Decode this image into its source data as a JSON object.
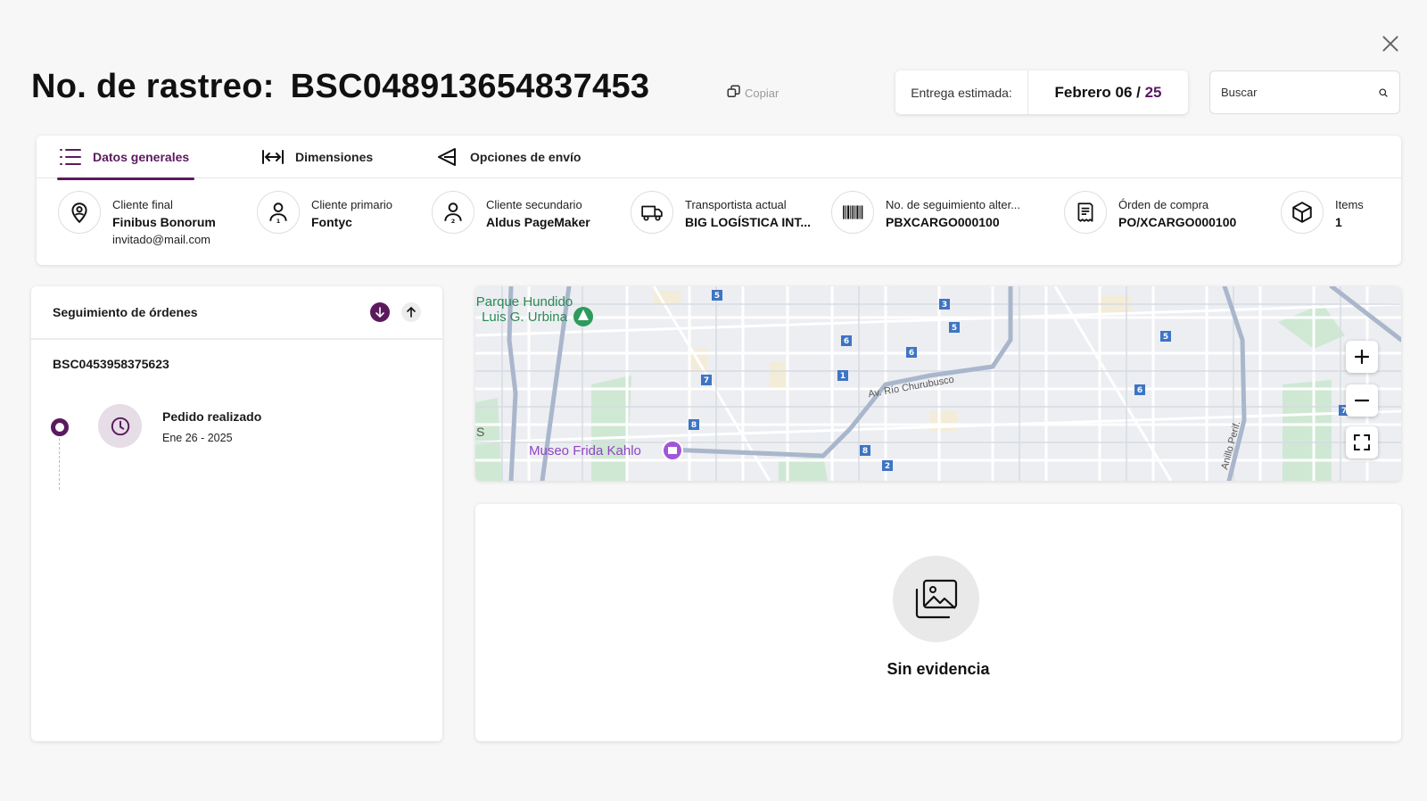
{
  "header": {
    "title_label": "No. de rastreo:",
    "tracking_number": "BSC0489136548374​53",
    "copy_label": "Copiar",
    "delivery_label": "Entrega estimada:",
    "delivery_date": "Febrero 06 /",
    "delivery_day": "25",
    "search_placeholder": "Buscar"
  },
  "tabs": [
    {
      "label": "Datos generales",
      "icon": "list-icon",
      "active": true
    },
    {
      "label": "Dimensiones",
      "icon": "dimensions-icon",
      "active": false
    },
    {
      "label": "Opciones de envío",
      "icon": "send-icon",
      "active": false
    }
  ],
  "fields": [
    {
      "label": "Cliente final",
      "value": "Finibus Bonorum",
      "sub": "invitado@mail.com",
      "icon": "location-pin-icon"
    },
    {
      "label": "Cliente primario",
      "value": "Fontyc",
      "icon": "user-1-icon"
    },
    {
      "label": "Cliente secundario",
      "value": "Aldus PageMaker",
      "icon": "user-2-icon"
    },
    {
      "label": "Transportista actual",
      "value": "BIG LOGÍSTICA INT...",
      "icon": "truck-icon"
    },
    {
      "label": "No. de seguimiento alter...",
      "value": "PBXCARGO000100",
      "icon": "barcode-icon"
    },
    {
      "label": "Órden de compra",
      "value": "PO/XCARGO000100",
      "icon": "receipt-icon"
    },
    {
      "label": "Items",
      "value": "1",
      "icon": "box-icon"
    }
  ],
  "tracking": {
    "title": "Seguimiento de órdenes",
    "order_number": "BSC0453958375623",
    "events": [
      {
        "title": "Pedido realizado",
        "date": "Ene 26 - 2025",
        "icon": "clock-icon"
      }
    ]
  },
  "map": {
    "labels": {
      "park": "Parque Hundido Luis G. Urbina",
      "museum": "Museo Frida Kahlo",
      "street": "Av. Río Churubusco",
      "street2": "Anillo Perif.",
      "edge": "S"
    },
    "route_markers": [
      "5",
      "3",
      "5",
      "6",
      "6",
      "1",
      "7",
      "8",
      "8",
      "2",
      "5",
      "6",
      "7"
    ]
  },
  "evidence": {
    "text": "Sin evidencia"
  },
  "colors": {
    "accent": "#5b1a5e",
    "background": "#f7f7f7"
  }
}
